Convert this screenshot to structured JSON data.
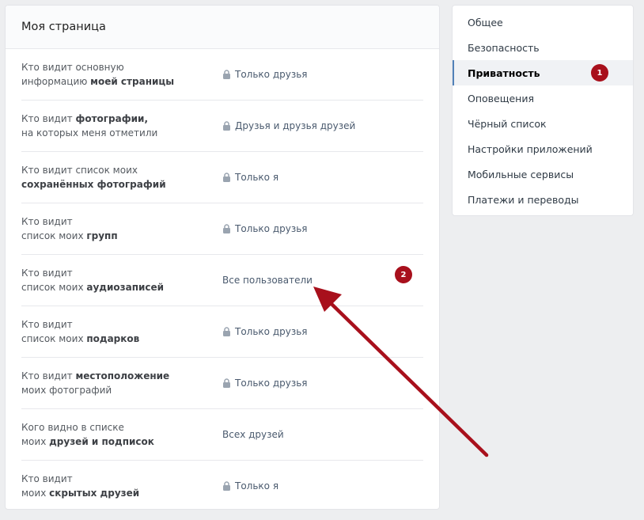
{
  "main": {
    "title": "Моя страница",
    "rows": [
      {
        "l1": [
          "Кто видит основную",
          ""
        ],
        "l2": [
          "информацию ",
          "моей страницы"
        ],
        "value": "Только друзья",
        "locked": true
      },
      {
        "l1": [
          "Кто видит ",
          "фотографии,"
        ],
        "l2": [
          "на которых меня отметили",
          ""
        ],
        "value": "Друзья и друзья друзей",
        "locked": true
      },
      {
        "l1": [
          "Кто видит список моих",
          ""
        ],
        "l2": [
          "",
          "сохранённых фотографий"
        ],
        "value": "Только я",
        "locked": true
      },
      {
        "l1": [
          "Кто видит",
          ""
        ],
        "l2": [
          "список моих ",
          "групп"
        ],
        "value": "Только друзья",
        "locked": true
      },
      {
        "l1": [
          "Кто видит",
          ""
        ],
        "l2": [
          "список моих ",
          "аудиозаписей"
        ],
        "value": "Все пользователи",
        "locked": false
      },
      {
        "l1": [
          "Кто видит",
          ""
        ],
        "l2": [
          "список моих ",
          "подарков"
        ],
        "value": "Только друзья",
        "locked": true
      },
      {
        "l1": [
          "Кто видит ",
          "местоположение"
        ],
        "l2": [
          "моих фотографий",
          ""
        ],
        "value": "Только друзья",
        "locked": true
      },
      {
        "l1": [
          "Кого видно в списке",
          ""
        ],
        "l2": [
          "моих ",
          "друзей и подписок"
        ],
        "value": "Всех друзей",
        "locked": false
      },
      {
        "l1": [
          "Кто видит",
          ""
        ],
        "l2": [
          "моих ",
          "скрытых друзей"
        ],
        "value": "Только я",
        "locked": true
      }
    ]
  },
  "sidebar": {
    "items": [
      {
        "label": "Общее"
      },
      {
        "label": "Безопасность"
      },
      {
        "label": "Приватность",
        "active": true
      },
      {
        "label": "Оповещения"
      },
      {
        "label": "Чёрный список"
      },
      {
        "label": "Настройки приложений"
      },
      {
        "label": "Мобильные сервисы"
      },
      {
        "label": "Платежи и переводы"
      }
    ]
  },
  "annotations": {
    "badge_1": "1",
    "badge_2": "2",
    "badge_color": "#a8101c",
    "arrow_color": "#a8101c"
  }
}
